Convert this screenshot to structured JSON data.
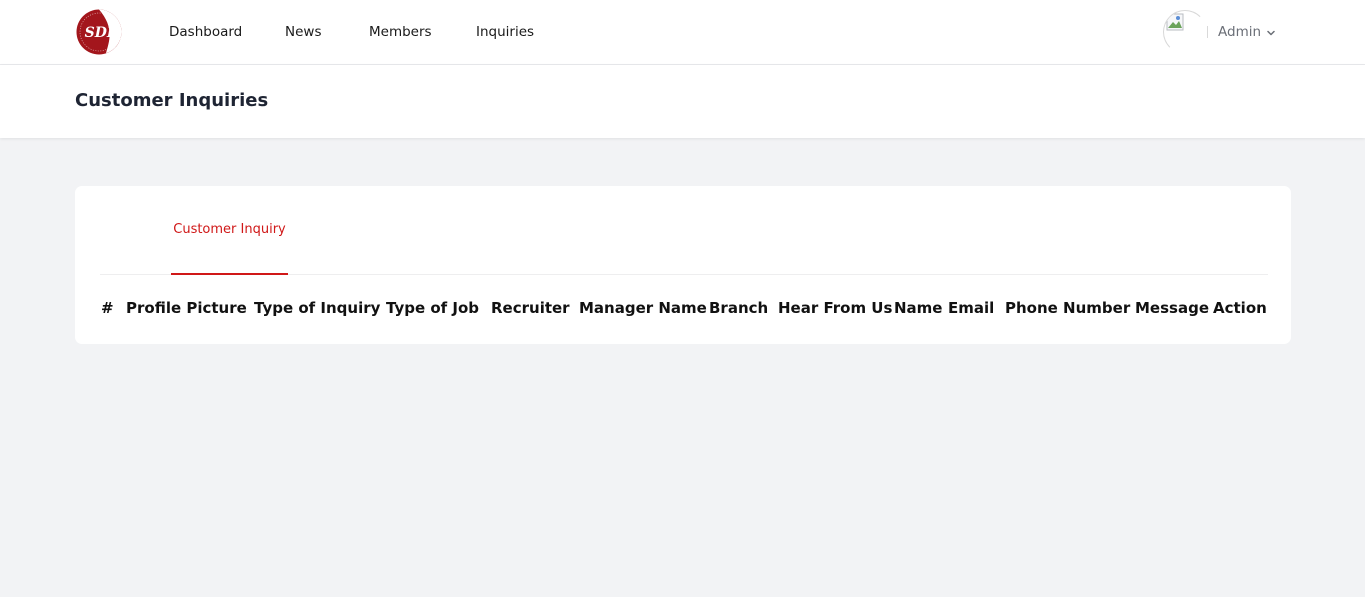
{
  "topbar": {
    "logo_text": "SDI",
    "nav": [
      {
        "label": "Dashboard"
      },
      {
        "label": "News"
      },
      {
        "label": "Members"
      },
      {
        "label": "Inquiries"
      }
    ],
    "user": {
      "name": "Admin",
      "avatar_icon": "broken-image-icon",
      "menu_icon": "chevron-down-icon"
    }
  },
  "header": {
    "title": "Customer Inquiries"
  },
  "card": {
    "tabs": [
      {
        "label": "Customer Inquiry",
        "active": true
      }
    ],
    "table": {
      "columns": [
        "#",
        "Profile Picture",
        "Type of Inquiry",
        "Type of Job",
        "Recruiter",
        "Manager Name",
        "Branch",
        "Hear From Us",
        "Name",
        "Email",
        "Phone Number",
        "Message",
        "Action"
      ],
      "rows": []
    }
  },
  "colors": {
    "accent": "#d01818",
    "page_background": "#f2f3f5",
    "logo_red": "#a3161c"
  }
}
